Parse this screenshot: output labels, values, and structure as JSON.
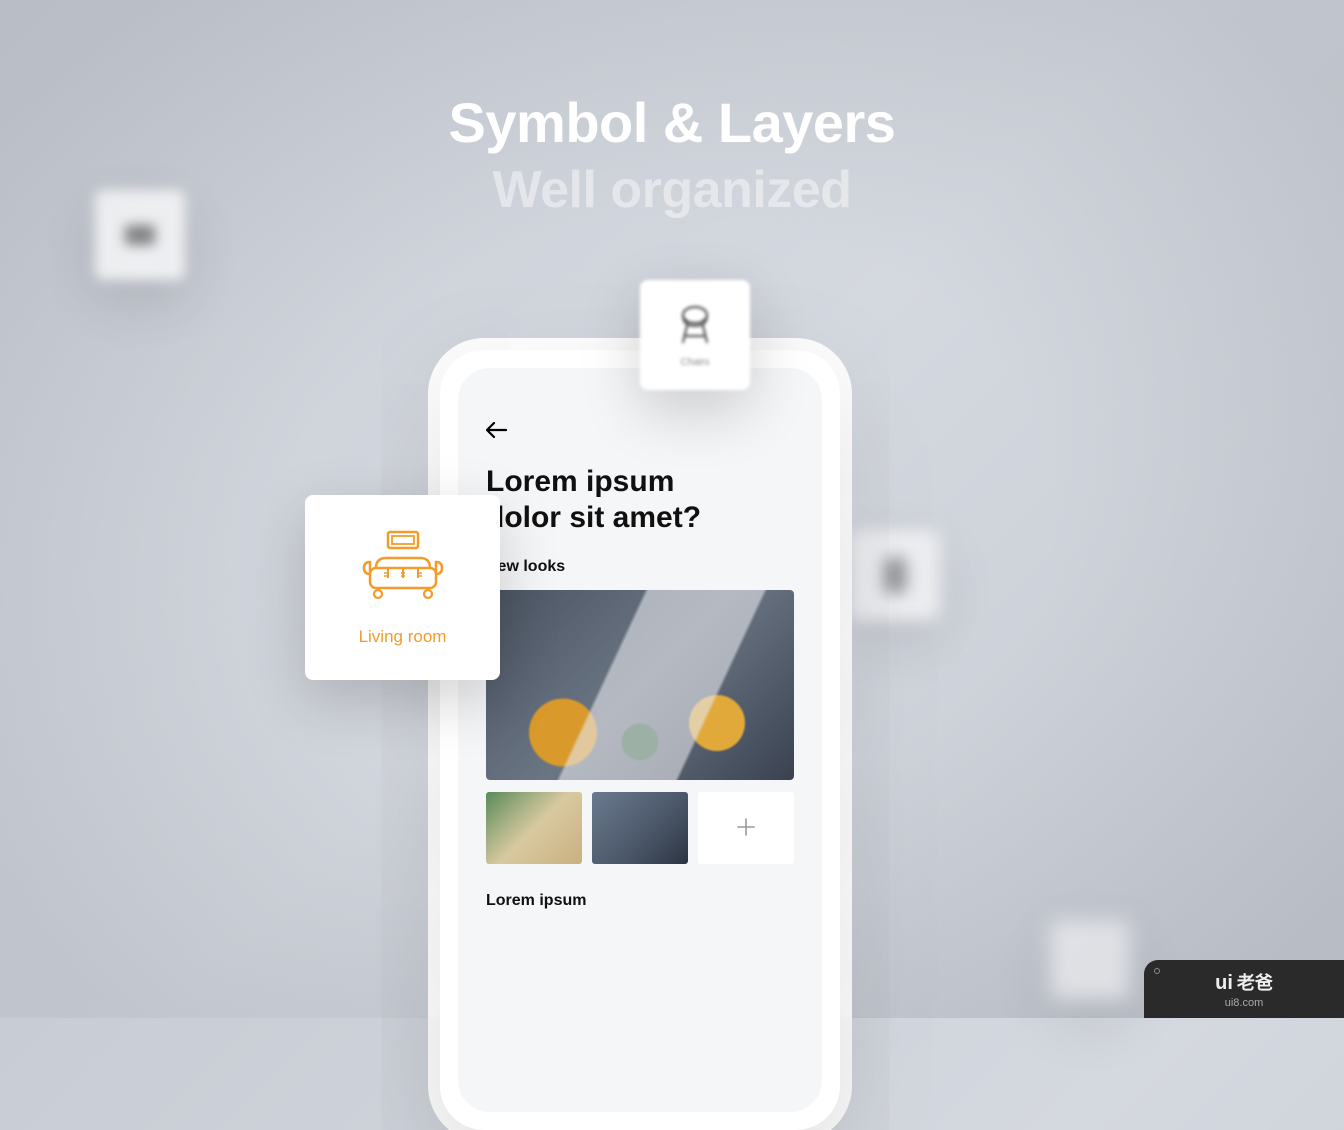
{
  "hero": {
    "title": "Symbol & Layers",
    "subtitle": "Well organized"
  },
  "phone": {
    "heading": "Lorem ipsum dolor sit amet?",
    "section_label": "New looks",
    "footer_label": "Lorem ipsum"
  },
  "cards": {
    "living_label": "Living room",
    "chair_label": "Chairs"
  },
  "watermark": {
    "brand_en": "ui",
    "brand_cn": "老爸",
    "url": "ui8.com"
  },
  "icons": {
    "back": "back-arrow-icon",
    "sofa": "sofa-icon",
    "chair": "chair-icon",
    "plus": "plus-icon"
  }
}
